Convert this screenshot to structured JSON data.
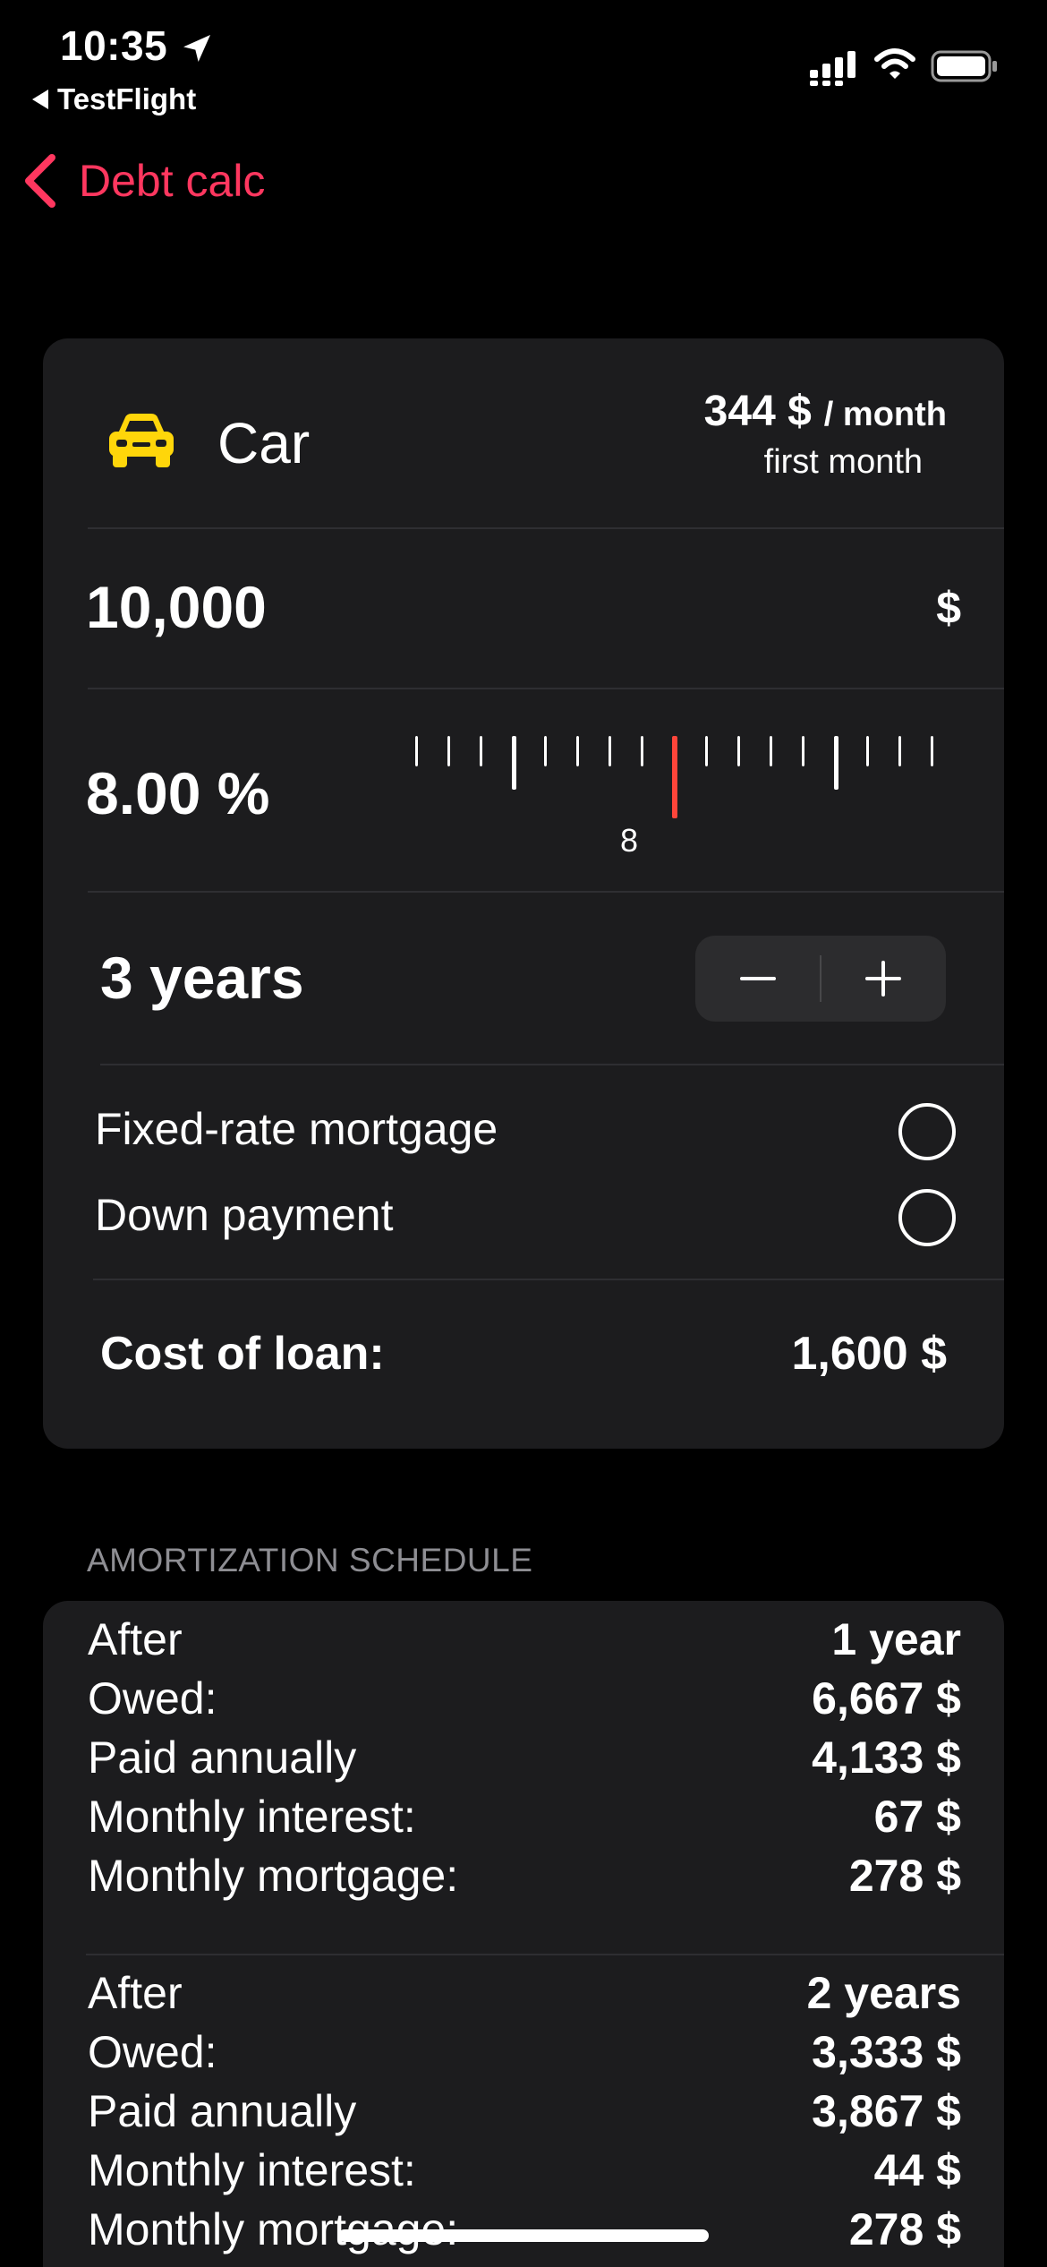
{
  "status_bar": {
    "time": "10:35",
    "back_app": "TestFlight"
  },
  "nav": {
    "back_label": "Debt calc"
  },
  "loan": {
    "type": "Car",
    "monthly_amount": "344 $",
    "monthly_unit": "/ month",
    "monthly_sub": "first month",
    "principal": "10,000",
    "currency": "$",
    "rate": "8.00 %",
    "rate_scale_label": "8",
    "term": "3 years",
    "stepper_minus": "−",
    "stepper_plus": "+",
    "options": [
      {
        "label": "Fixed-rate mortgage",
        "checked": false
      },
      {
        "label": "Down payment",
        "checked": false
      }
    ],
    "cost_label": "Cost of loan:",
    "cost_value": "1,600 $"
  },
  "schedule": {
    "header": "AMORTIZATION SCHEDULE",
    "blocks": [
      {
        "rows": [
          {
            "label": "After",
            "value": "1 year"
          },
          {
            "label": "Owed:",
            "value": "6,667 $"
          },
          {
            "label": "Paid annually",
            "value": "4,133 $"
          },
          {
            "label": "Monthly interest:",
            "value": "67 $"
          },
          {
            "label": "Monthly mortgage:",
            "value": "278 $"
          }
        ]
      },
      {
        "rows": [
          {
            "label": "After",
            "value": "2 years"
          },
          {
            "label": "Owed:",
            "value": "3,333 $"
          },
          {
            "label": "Paid annually",
            "value": "3,867 $"
          },
          {
            "label": "Monthly interest:",
            "value": "44 $"
          },
          {
            "label": "Monthly mortgage:",
            "value": "278 $"
          }
        ]
      }
    ]
  },
  "colors": {
    "accent": "#ff375f",
    "car_icon": "#ffd60a",
    "card_bg": "#1c1c1e",
    "ruler_marker": "#ff453a"
  }
}
